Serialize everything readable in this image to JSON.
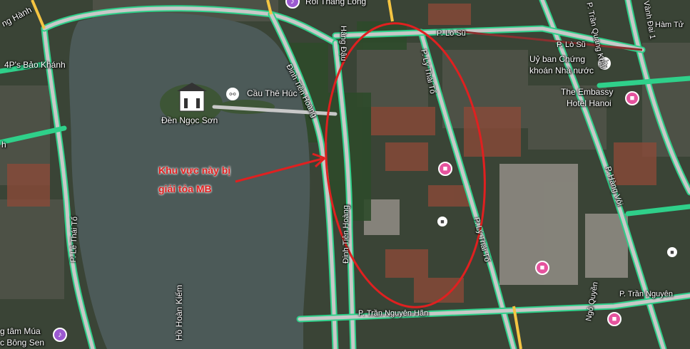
{
  "map": {
    "labels": {
      "roi_thang_long": "Rối Thăng Long",
      "hang_hanh": "ng Hành",
      "bao_khanh": "4P's Bảo Khánh",
      "cau_the_huc": "Cầu Thê Húc",
      "den_ngoc_son": "Đền Ngọc Sơn",
      "dinh_tien_hoang_top": "Đinh Tiên Hoàng",
      "dinh_tien_hoang_bottom": "Đinh Tiên Hoàng",
      "hang_dau": "Hàng Đậu",
      "ly_thai_to_top": "P. Lý Thái Tổ",
      "ly_thai_to_bottom": "P. Lý Thái Tổ",
      "le_thai_to": "P. Lê Thái Tổ",
      "lo_su_left": "P. Lò Sũ",
      "lo_su_right": "P. Lò Sũ",
      "tran_quang_khai": "P. Trần Quang Khải",
      "vanh_dai_1": "Vành Đai 1",
      "ham_tu": "Hàm Tử",
      "uy_ban_line1": "Uỷ ban Chứng",
      "uy_ban_line2": "khoán Nhà nước",
      "embassy_line1": "The Embassy",
      "embassy_line2": "Hotel Hanoi",
      "hang_voi": "P. Hàng Vôi",
      "tran_nguyen_han_bottom": "P. Trần Nguyên Hãn",
      "tran_nguyen_han_right": "P. Trần Nguyên",
      "ngo_quyen": "Ngô Quyền",
      "ho_hoan_kiem": "Hồ Hoàn Kiếm",
      "mua_line1": "g tâm Múa",
      "mua_line2": "c Bông Sen",
      "left_h": "h"
    },
    "annotation": {
      "line1": "Khu vực này bị",
      "line2": "giải tỏa MB",
      "color": "#e02020"
    },
    "colors": {
      "road_outline": "#2fd08a",
      "road_fill": "#c8c8c8",
      "water": "#4c5a58",
      "major_road": "#f5c542"
    },
    "icons": [
      "temple-icon",
      "bridge-icon",
      "hotel-icon",
      "government-icon",
      "bus-stop-icon",
      "theater-icon"
    ]
  }
}
